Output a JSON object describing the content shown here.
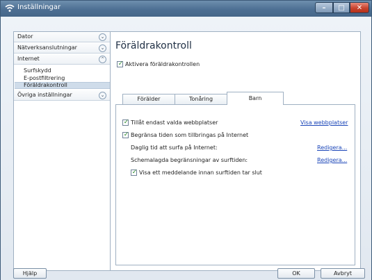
{
  "window": {
    "title": "Inställningar",
    "icon": "wifi-shield-icon"
  },
  "controls": {
    "minimize": "–",
    "maximize": "□",
    "close": "✕"
  },
  "sidebar": {
    "groups": [
      {
        "label": "Dator",
        "expanded": false
      },
      {
        "label": "Nätverksanslutningar",
        "expanded": false
      },
      {
        "label": "Internet",
        "expanded": true
      },
      {
        "label": "Övriga inställningar",
        "expanded": false
      }
    ],
    "internet_items": [
      "Surfskydd",
      "E-postfiltrering",
      "Föräldrakontroll"
    ],
    "selected_item": "Föräldrakontroll"
  },
  "panel": {
    "title": "Föräldrakontroll",
    "enable_label": "Aktivera föräldrakontrollen",
    "tabs": [
      "Förälder",
      "Tonåring",
      "Barn"
    ],
    "active_tab": "Barn",
    "options": {
      "allow_only_label": "Tillåt endast valda webbplatser",
      "show_sites_link": "Visa webbplatser",
      "limit_time_label": "Begränsa tiden som tillbringas på Internet",
      "daily_time_label": "Daglig tid att surfa på Internet:",
      "daily_edit_link": "Redigera...",
      "schedule_label": "Schemalagda begränsningar av surftiden:",
      "schedule_edit_link": "Redigera...",
      "message_label": "Visa ett meddelande innan surftiden tar slut"
    }
  },
  "footer": {
    "help": "Hjälp",
    "ok": "OK",
    "cancel": "Avbryt"
  }
}
